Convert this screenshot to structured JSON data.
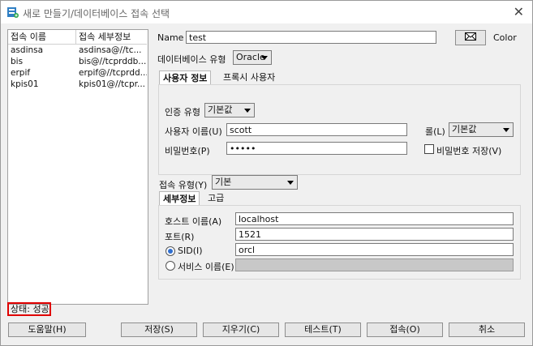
{
  "window": {
    "title": "새로 만들기/데이터베이스 접속 선택"
  },
  "connections": {
    "headers": [
      "접속 이름",
      "접속 세부정보"
    ],
    "rows": [
      [
        "asdinsa",
        "asdinsa@//tc..."
      ],
      [
        "bis",
        "bis@//tcprddb..."
      ],
      [
        "erpif",
        "erpif@//tcprdd..."
      ],
      [
        "kpis01",
        "kpis01@//tcpr..."
      ]
    ]
  },
  "form": {
    "name_label": "Name",
    "name_value": "test",
    "color_label": "Color",
    "db_type_label": "데이터베이스 유형",
    "db_type_value": "Oracle",
    "tabs": [
      "사용자 정보",
      "프록시 사용자"
    ],
    "auth_type_label": "인증 유형",
    "auth_type_value": "기본값",
    "username_label": "사용자 이름(U)",
    "username_value": "scott",
    "role_label": "롤(L)",
    "role_value": "기본값",
    "password_label": "비밀번호(P)",
    "password_value": "•••••",
    "save_password_label": "비밀번호 저장(V)",
    "conn_type_label": "접속 유형(Y)",
    "conn_type_value": "기본",
    "detail_tabs": [
      "세부정보",
      "고급"
    ],
    "host_label": "호스트 이름(A)",
    "host_value": "localhost",
    "port_label": "포트(R)",
    "port_value": "1521",
    "sid_label": "SID(I)",
    "sid_value": "orcl",
    "service_label": "서비스 이름(E)"
  },
  "status": "상태: 성공",
  "buttons": {
    "help": "도움말(H)",
    "save": "저장(S)",
    "clear": "지우기(C)",
    "test": "테스트(T)",
    "connect": "접속(O)",
    "cancel": "취소"
  },
  "colors": {
    "status_border": "#e00000",
    "radio_accent": "#2f6fd0"
  }
}
